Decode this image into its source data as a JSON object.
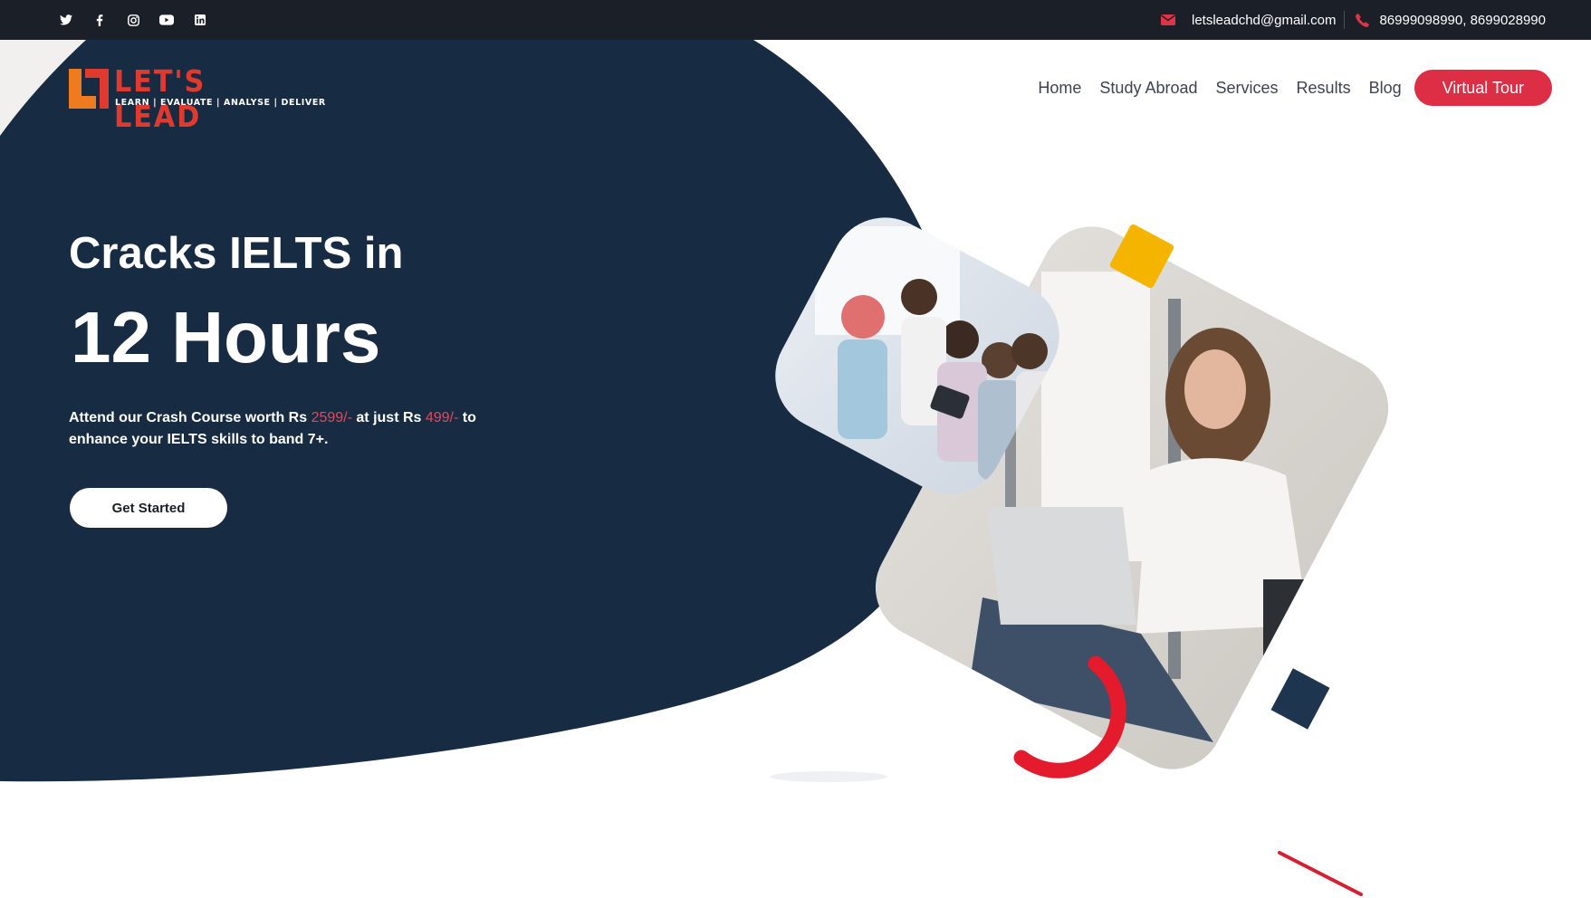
{
  "topbar": {
    "social_icons": [
      "twitter-icon",
      "facebook-icon",
      "instagram-icon",
      "youtube-icon",
      "linkedin-icon"
    ],
    "email": "letsleadchd@gmail.com",
    "phone": "86999098990, 8699028990"
  },
  "logo": {
    "name": "LET'S LEAD",
    "tagline": "LEARN | EVALUATE | ANALYSE | DELIVER"
  },
  "nav": {
    "home": "Home",
    "study_abroad": "Study Abroad",
    "services": "Services",
    "results": "Results",
    "blog": "Blog",
    "virtual_tour": "Virtual Tour"
  },
  "hero": {
    "heading_line1": "Cracks IELTS in",
    "heading_line2": "12 Hours",
    "desc_part1": "Attend our Crash Course worth Rs ",
    "price_original": "2599/-",
    "desc_part2": " at just Rs ",
    "price_offer": "499/-",
    "desc_part3": " to enhance your IELTS skills to band 7+.",
    "cta_label": "Get Started"
  },
  "colors": {
    "navy": "#172b43",
    "accent_red": "#dc2f45",
    "topbar": "#1b1f27",
    "yellow": "#f5b400"
  }
}
